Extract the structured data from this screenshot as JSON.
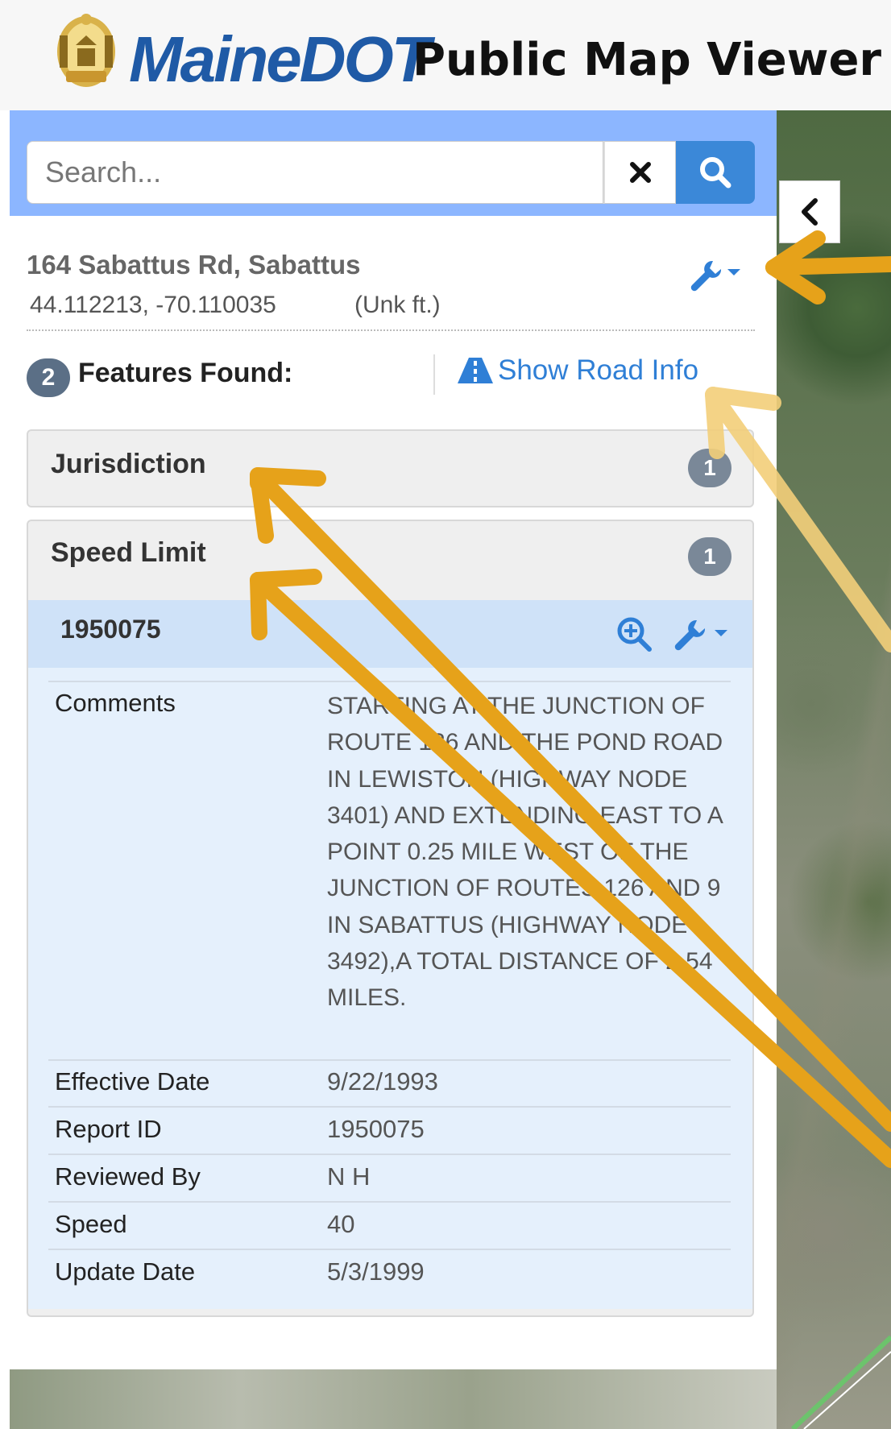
{
  "header": {
    "brand": "MaineDOT",
    "title": "Public Map Viewer",
    "seal_icon": "maine-seal-icon"
  },
  "search": {
    "placeholder": "Search...",
    "clear_icon": "close-icon",
    "search_icon": "search-icon"
  },
  "location": {
    "address": "164 Sabattus Rd, Sabattus",
    "coords": "44.112213, -70.110035",
    "elevation": "(Unk ft.)"
  },
  "features": {
    "count": "2",
    "label": "Features Found:",
    "road_info_label": "Show Road Info"
  },
  "accordions": [
    {
      "title": "Jurisdiction",
      "count": "1"
    },
    {
      "title": "Speed Limit",
      "count": "1"
    }
  ],
  "detail": {
    "id": "1950075",
    "rows": [
      {
        "label": "Comments",
        "value": "STARTING AT THE JUNCTION OF ROUTE 126 AND THE POND ROAD IN LEWISTON (HIGHWAY NODE 3401) AND EXTENDING EAST TO A POINT 0.25 MILE WEST OF THE JUNCTION OF ROUTES 126 AND 9 IN SABATTUS (HIGHWAY NODE 3492),A TOTAL DISTANCE OF 2.54 MILES."
      },
      {
        "label": "Effective Date",
        "value": "9/22/1993"
      },
      {
        "label": "Report ID",
        "value": "1950075"
      },
      {
        "label": "Reviewed By",
        "value": "N H"
      },
      {
        "label": "Speed",
        "value": "40"
      },
      {
        "label": "Update Date",
        "value": "5/3/1999"
      }
    ]
  },
  "colors": {
    "brand_blue": "#1f5aa6",
    "search_bar": "#8cb6ff",
    "link_blue": "#2f7fd6",
    "annotation_arrow": "#e6a21a"
  }
}
